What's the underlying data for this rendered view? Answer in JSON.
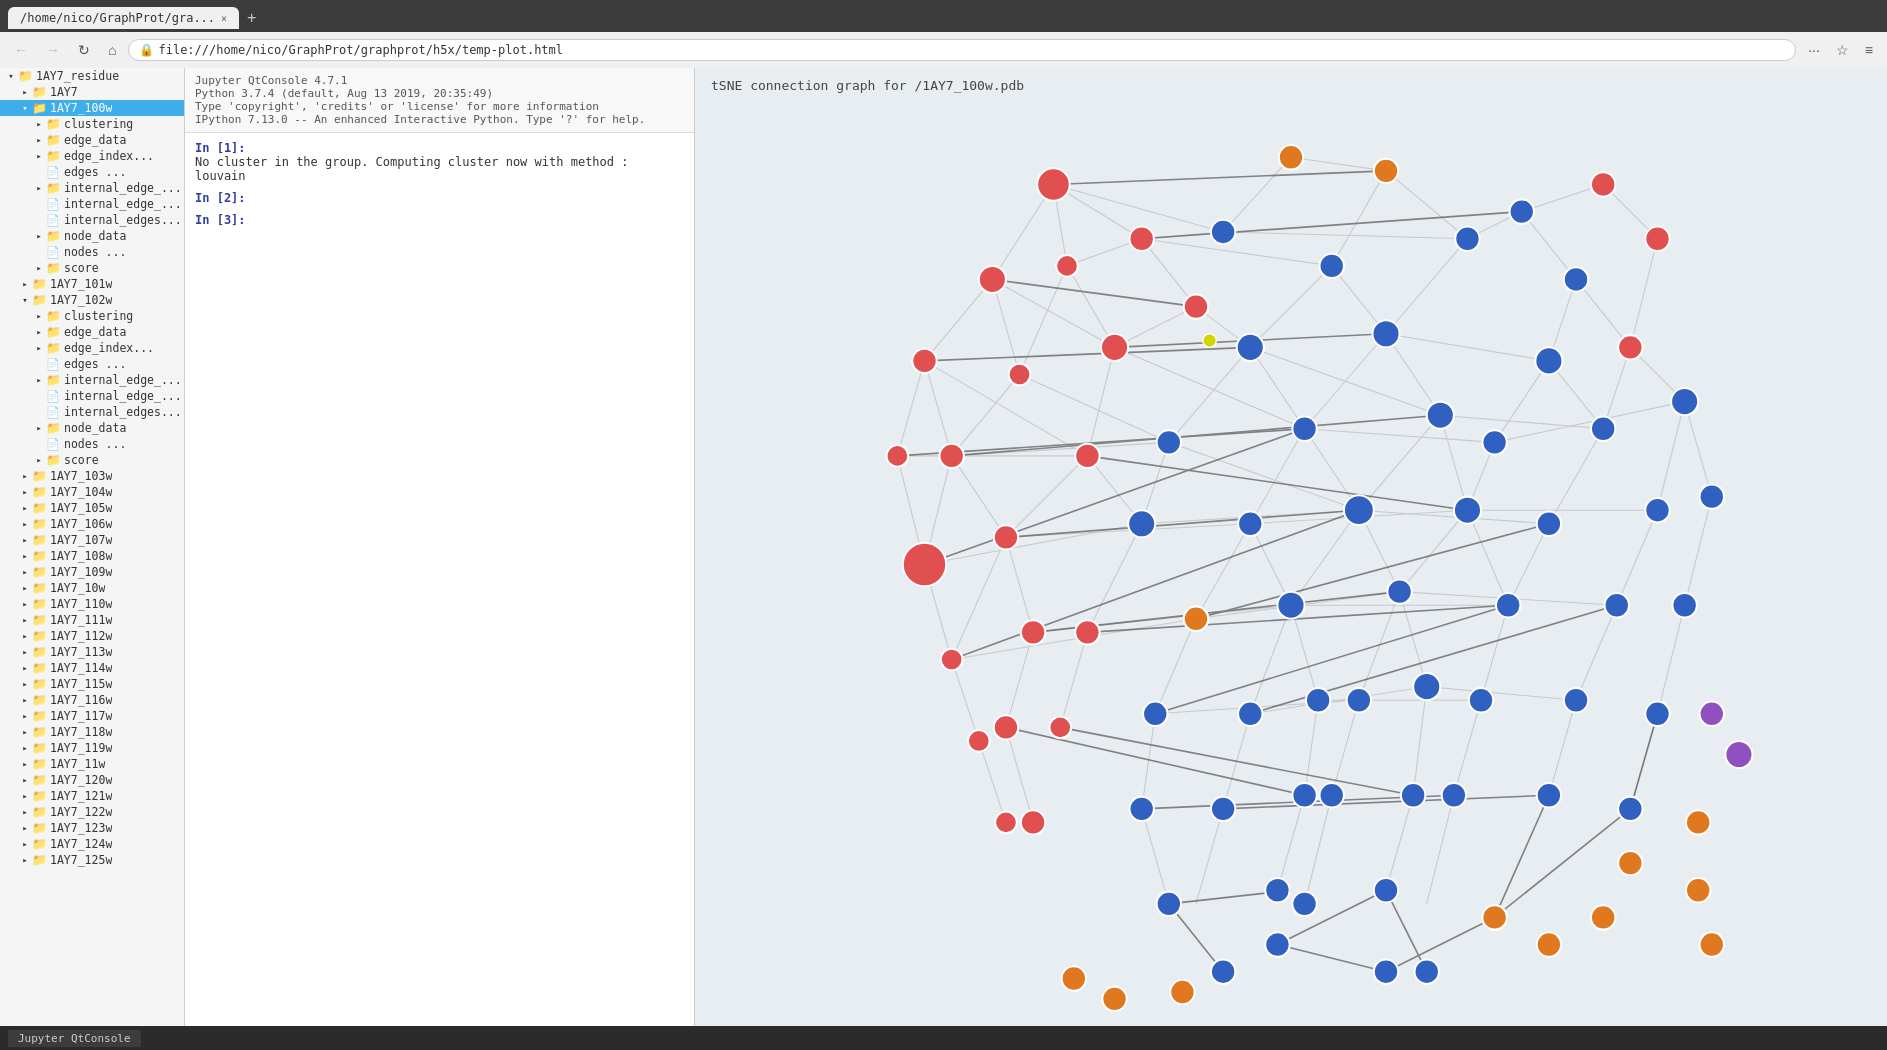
{
  "browser": {
    "tab_title": "/home/nico/GraphProt/gra...",
    "tab_close": "×",
    "tab_new": "+",
    "back_btn": "←",
    "forward_btn": "→",
    "refresh_btn": "↻",
    "home_btn": "⌂",
    "address": "file:///home/nico/GraphProt/graphprot/h5x/temp-plot.html",
    "more_btn": "···",
    "bookmark_btn": "☆",
    "menu_btn": "≡"
  },
  "jupyter": {
    "title": "Jupyter QtConsole 4.7.1",
    "line1": "Python 3.7.4 (default, Aug 13 2019, 20:35:49)",
    "line2": "Type 'copyright', 'credits' or 'license' for more information",
    "line3": "IPython 7.13.0 -- An enhanced Interactive Python. Type '?' for help.",
    "in1": "In [1]:",
    "out1": "No cluster in the group. Computing cluster now with method : louvain",
    "in2": "In [2]:",
    "in3": "In [3]:"
  },
  "graph": {
    "title": "tSNE connection graph for /1AY7_100w.pdb"
  },
  "filetree": {
    "items": [
      {
        "label": "1AY7_residue",
        "level": 0,
        "type": "folder",
        "expanded": true,
        "selected": false
      },
      {
        "label": "1AY7",
        "level": 1,
        "type": "folder",
        "expanded": false,
        "selected": false
      },
      {
        "label": "1AY7_100w",
        "level": 1,
        "type": "folder",
        "expanded": true,
        "selected": true
      },
      {
        "label": "clustering",
        "level": 2,
        "type": "folder",
        "expanded": false,
        "selected": false
      },
      {
        "label": "edge_data",
        "level": 2,
        "type": "folder",
        "expanded": false,
        "selected": false
      },
      {
        "label": "edge_index...",
        "level": 2,
        "type": "folder",
        "expanded": false,
        "selected": false
      },
      {
        "label": "edges  ...",
        "level": 2,
        "type": "file",
        "expanded": false,
        "selected": false
      },
      {
        "label": "internal_edge_...",
        "level": 2,
        "type": "folder",
        "expanded": false,
        "selected": false
      },
      {
        "label": "internal_edge_...",
        "level": 2,
        "type": "file",
        "expanded": false,
        "selected": false
      },
      {
        "label": "internal_edges...",
        "level": 2,
        "type": "file",
        "expanded": false,
        "selected": false
      },
      {
        "label": "node_data",
        "level": 2,
        "type": "folder",
        "expanded": false,
        "selected": false
      },
      {
        "label": "nodes  ...",
        "level": 2,
        "type": "file",
        "expanded": false,
        "selected": false
      },
      {
        "label": "score",
        "level": 2,
        "type": "folder",
        "expanded": false,
        "selected": false
      },
      {
        "label": "1AY7_101w",
        "level": 1,
        "type": "folder",
        "expanded": false,
        "selected": false
      },
      {
        "label": "1AY7_102w",
        "level": 1,
        "type": "folder",
        "expanded": true,
        "selected": false
      },
      {
        "label": "clustering",
        "level": 2,
        "type": "folder",
        "expanded": false,
        "selected": false
      },
      {
        "label": "edge_data",
        "level": 2,
        "type": "folder",
        "expanded": false,
        "selected": false
      },
      {
        "label": "edge_index...",
        "level": 2,
        "type": "folder",
        "expanded": false,
        "selected": false
      },
      {
        "label": "edges  ...",
        "level": 2,
        "type": "file",
        "expanded": false,
        "selected": false
      },
      {
        "label": "internal_edge_...",
        "level": 2,
        "type": "folder",
        "expanded": false,
        "selected": false
      },
      {
        "label": "internal_edge_...",
        "level": 2,
        "type": "file",
        "expanded": false,
        "selected": false
      },
      {
        "label": "internal_edges...",
        "level": 2,
        "type": "file",
        "expanded": false,
        "selected": false
      },
      {
        "label": "node_data",
        "level": 2,
        "type": "folder",
        "expanded": false,
        "selected": false
      },
      {
        "label": "nodes  ...",
        "level": 2,
        "type": "file",
        "expanded": false,
        "selected": false
      },
      {
        "label": "score",
        "level": 2,
        "type": "folder",
        "expanded": false,
        "selected": false
      },
      {
        "label": "1AY7_103w",
        "level": 1,
        "type": "folder",
        "expanded": false,
        "selected": false
      },
      {
        "label": "1AY7_104w",
        "level": 1,
        "type": "folder",
        "expanded": false,
        "selected": false
      },
      {
        "label": "1AY7_105w",
        "level": 1,
        "type": "folder",
        "expanded": false,
        "selected": false
      },
      {
        "label": "1AY7_106w",
        "level": 1,
        "type": "folder",
        "expanded": false,
        "selected": false
      },
      {
        "label": "1AY7_107w",
        "level": 1,
        "type": "folder",
        "expanded": false,
        "selected": false
      },
      {
        "label": "1AY7_108w",
        "level": 1,
        "type": "folder",
        "expanded": false,
        "selected": false
      },
      {
        "label": "1AY7_109w",
        "level": 1,
        "type": "folder",
        "expanded": false,
        "selected": false
      },
      {
        "label": "1AY7_10w",
        "level": 1,
        "type": "folder",
        "expanded": false,
        "selected": false
      },
      {
        "label": "1AY7_110w",
        "level": 1,
        "type": "folder",
        "expanded": false,
        "selected": false
      },
      {
        "label": "1AY7_111w",
        "level": 1,
        "type": "folder",
        "expanded": false,
        "selected": false
      },
      {
        "label": "1AY7_112w",
        "level": 1,
        "type": "folder",
        "expanded": false,
        "selected": false
      },
      {
        "label": "1AY7_113w",
        "level": 1,
        "type": "folder",
        "expanded": false,
        "selected": false
      },
      {
        "label": "1AY7_114w",
        "level": 1,
        "type": "folder",
        "expanded": false,
        "selected": false
      },
      {
        "label": "1AY7_115w",
        "level": 1,
        "type": "folder",
        "expanded": false,
        "selected": false
      },
      {
        "label": "1AY7_116w",
        "level": 1,
        "type": "folder",
        "expanded": false,
        "selected": false
      },
      {
        "label": "1AY7_117w",
        "level": 1,
        "type": "folder",
        "expanded": false,
        "selected": false
      },
      {
        "label": "1AY7_118w",
        "level": 1,
        "type": "folder",
        "expanded": false,
        "selected": false
      },
      {
        "label": "1AY7_119w",
        "level": 1,
        "type": "folder",
        "expanded": false,
        "selected": false
      },
      {
        "label": "1AY7_11w",
        "level": 1,
        "type": "folder",
        "expanded": false,
        "selected": false
      },
      {
        "label": "1AY7_120w",
        "level": 1,
        "type": "folder",
        "expanded": false,
        "selected": false
      },
      {
        "label": "1AY7_121w",
        "level": 1,
        "type": "folder",
        "expanded": false,
        "selected": false
      },
      {
        "label": "1AY7_122w",
        "level": 1,
        "type": "folder",
        "expanded": false,
        "selected": false
      },
      {
        "label": "1AY7_123w",
        "level": 1,
        "type": "folder",
        "expanded": false,
        "selected": false
      },
      {
        "label": "1AY7_124w",
        "level": 1,
        "type": "folder",
        "expanded": false,
        "selected": false
      },
      {
        "label": "1AY7_125w",
        "level": 1,
        "type": "folder",
        "expanded": false,
        "selected": false
      }
    ]
  }
}
